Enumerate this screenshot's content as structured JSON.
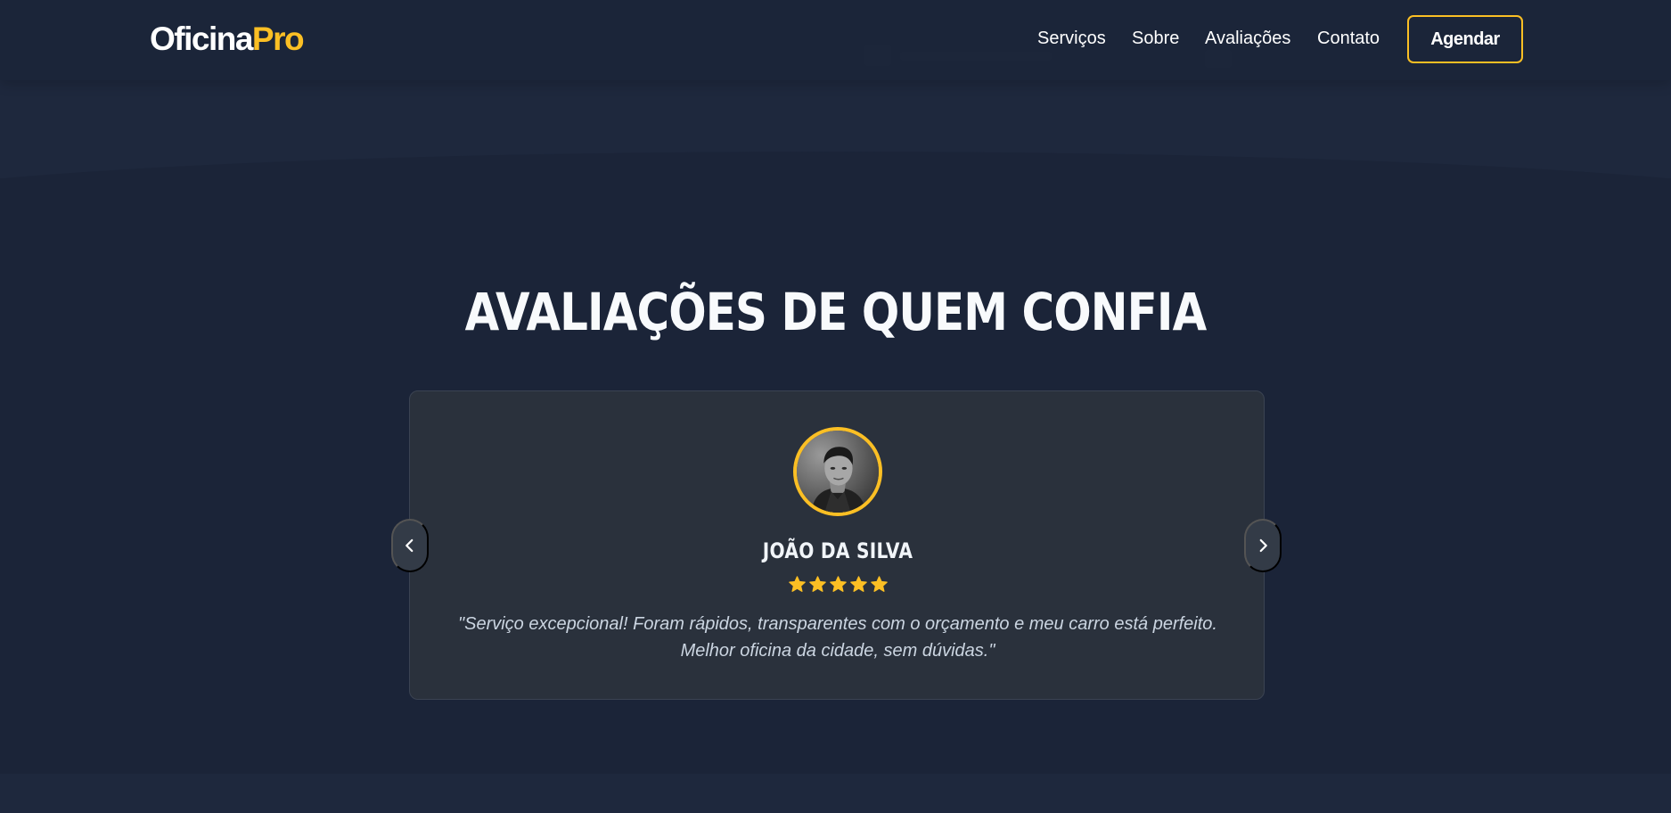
{
  "header": {
    "logo_main": "Oficina",
    "logo_accent": "Pro",
    "nav": [
      {
        "label": "Serviços"
      },
      {
        "label": "Sobre"
      },
      {
        "label": "Avaliações"
      },
      {
        "label": "Contato"
      }
    ],
    "cta_label": "Agendar"
  },
  "testimonials": {
    "title": "AVALIAÇÕES DE QUEM CONFIA",
    "current": {
      "name": "JOÃO DA SILVA",
      "rating": 5,
      "quote_line1": "\"Serviço excepcional! Foram rápidos, transparentes com o orçamento e meu carro está perfeito.",
      "quote_line2": "Melhor oficina da cidade, sem dúvidas.\""
    },
    "prev_icon": "chevron-left-icon",
    "next_icon": "chevron-right-icon"
  },
  "colors": {
    "background": "#1b2438",
    "accent": "#fbbf24",
    "card": "#2a313c"
  }
}
